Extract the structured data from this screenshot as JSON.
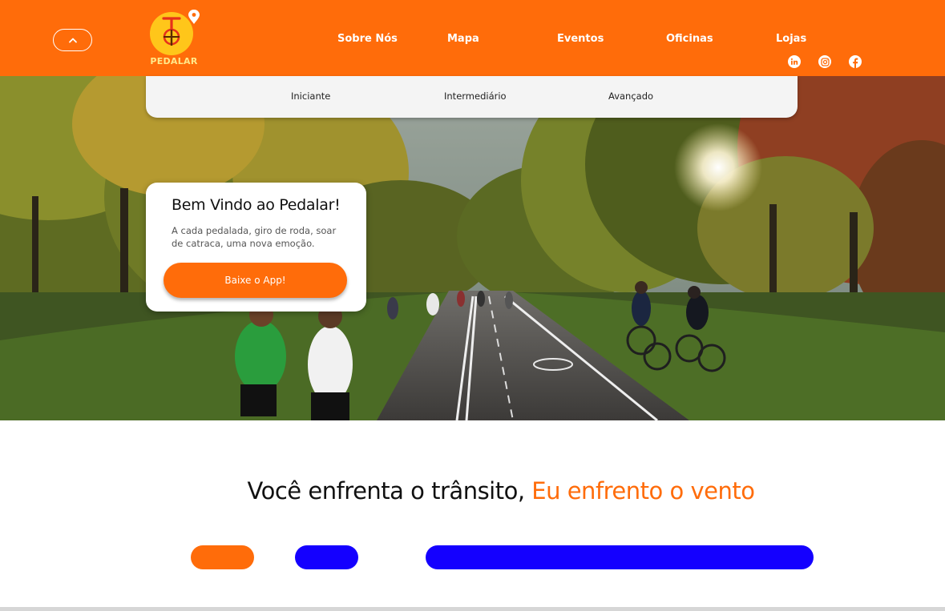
{
  "colors": {
    "brand": "#ff6c0a",
    "accent_blue": "#1400ff",
    "submenu_bg": "#f4f4f4"
  },
  "header": {
    "logo_text": "PEDALAR",
    "nav": [
      {
        "label": "Sobre Nós"
      },
      {
        "label": "Mapa"
      },
      {
        "label": "Eventos"
      },
      {
        "label": "Oficinas"
      },
      {
        "label": "Lojas"
      }
    ],
    "social": [
      "linkedin-icon",
      "instagram-icon",
      "facebook-icon"
    ]
  },
  "submenu": [
    "Iniciante",
    "Intermediário",
    "Avançado"
  ],
  "welcome": {
    "title": "Bem Vindo ao Pedalar!",
    "text": "A cada pedalada, giro de roda, soar de catraca, uma nova emoção.",
    "button": "Baixe o App!"
  },
  "tagline": {
    "part1": "Você enfrenta o trânsito, ",
    "part2": "Eu enfrento o vento"
  }
}
